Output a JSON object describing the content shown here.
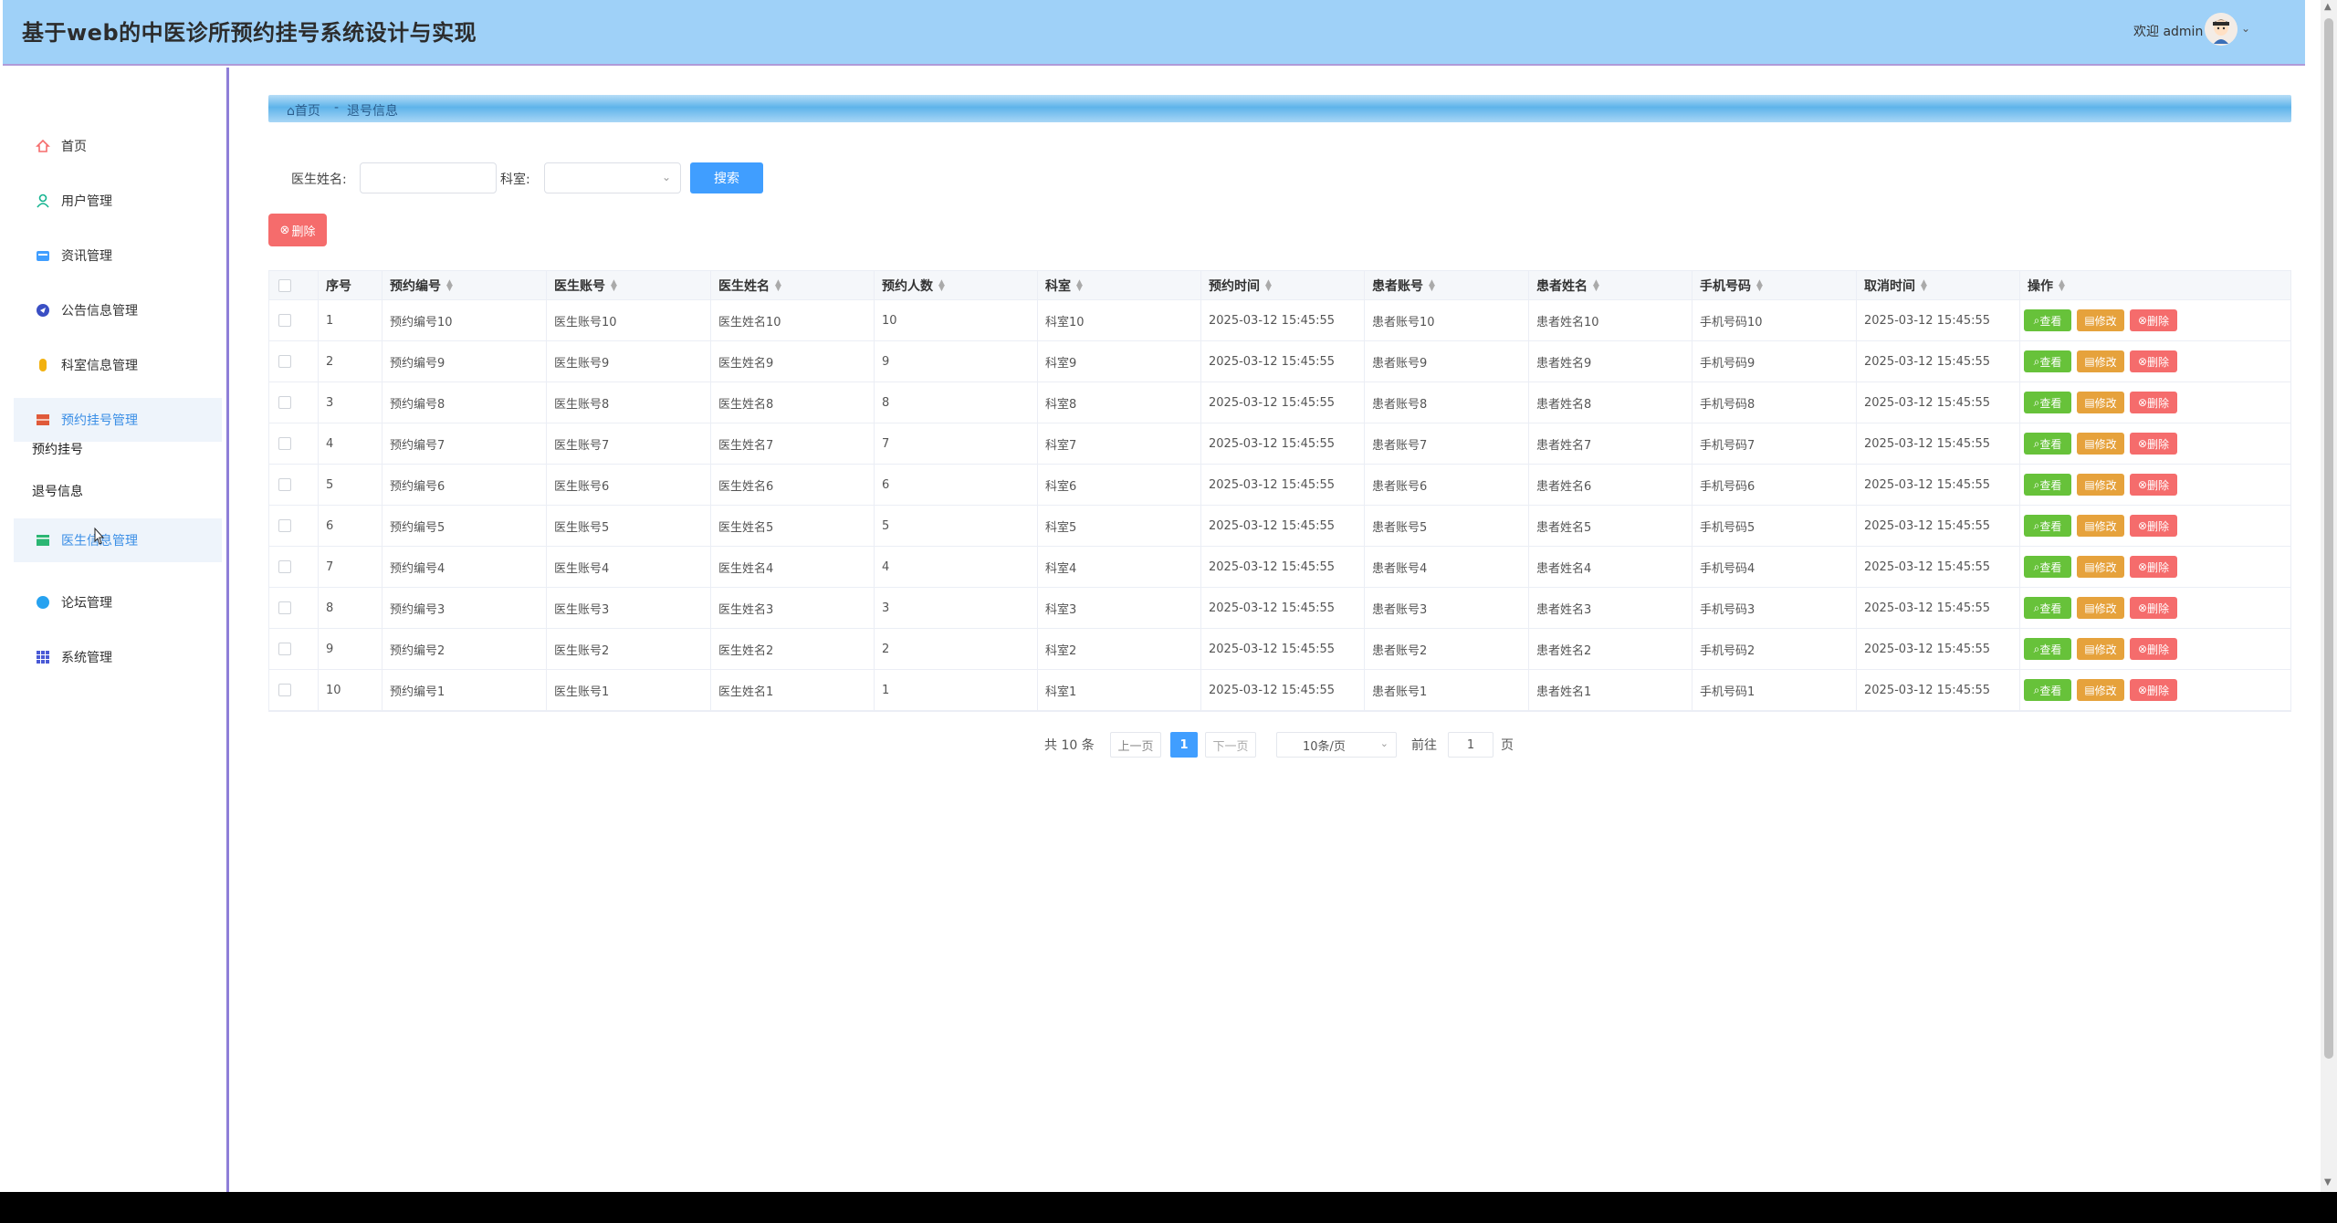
{
  "header": {
    "title": "基于web的中医诊所预约挂号系统设计与实现",
    "welcome": "欢迎 admin"
  },
  "sidebar": {
    "items": [
      {
        "label": "首页",
        "icon": "home-icon",
        "color": "#f56c6c"
      },
      {
        "label": "用户管理",
        "icon": "user-icon",
        "color": "#13b38f"
      },
      {
        "label": "资讯管理",
        "icon": "news-icon",
        "color": "#409eff"
      },
      {
        "label": "公告信息管理",
        "icon": "notice-icon",
        "color": "#3a4fc4"
      },
      {
        "label": "科室信息管理",
        "icon": "department-icon",
        "color": "#f2b10f"
      },
      {
        "label": "预约挂号管理",
        "icon": "appointment-icon",
        "color": "#e05a3a"
      },
      {
        "label": "医生信息管理",
        "icon": "doctor-icon",
        "color": "#2bb673"
      },
      {
        "label": "论坛管理",
        "icon": "forum-icon",
        "color": "#27a2f0"
      },
      {
        "label": "系统管理",
        "icon": "system-icon",
        "color": "#4a5ad6"
      }
    ],
    "sub_items": [
      "预约挂号",
      "退号信息"
    ]
  },
  "breadcrumb": {
    "home": "首页",
    "separator": "-",
    "current": "退号信息"
  },
  "search": {
    "doctor_name_label": "医生姓名:",
    "department_label": "科室:",
    "search_button": "搜索",
    "delete_button": "删除"
  },
  "table": {
    "headers": [
      "序号",
      "预约编号",
      "医生账号",
      "医生姓名",
      "预约人数",
      "科室",
      "预约时间",
      "患者账号",
      "患者姓名",
      "手机号码",
      "取消时间",
      "操作"
    ],
    "rows": [
      [
        "1",
        "预约编号10",
        "医生账号10",
        "医生姓名10",
        "10",
        "科室10",
        "2025-03-12 15:45:55",
        "患者账号10",
        "患者姓名10",
        "手机号码10",
        "2025-03-12 15:45:55"
      ],
      [
        "2",
        "预约编号9",
        "医生账号9",
        "医生姓名9",
        "9",
        "科室9",
        "2025-03-12 15:45:55",
        "患者账号9",
        "患者姓名9",
        "手机号码9",
        "2025-03-12 15:45:55"
      ],
      [
        "3",
        "预约编号8",
        "医生账号8",
        "医生姓名8",
        "8",
        "科室8",
        "2025-03-12 15:45:55",
        "患者账号8",
        "患者姓名8",
        "手机号码8",
        "2025-03-12 15:45:55"
      ],
      [
        "4",
        "预约编号7",
        "医生账号7",
        "医生姓名7",
        "7",
        "科室7",
        "2025-03-12 15:45:55",
        "患者账号7",
        "患者姓名7",
        "手机号码7",
        "2025-03-12 15:45:55"
      ],
      [
        "5",
        "预约编号6",
        "医生账号6",
        "医生姓名6",
        "6",
        "科室6",
        "2025-03-12 15:45:55",
        "患者账号6",
        "患者姓名6",
        "手机号码6",
        "2025-03-12 15:45:55"
      ],
      [
        "6",
        "预约编号5",
        "医生账号5",
        "医生姓名5",
        "5",
        "科室5",
        "2025-03-12 15:45:55",
        "患者账号5",
        "患者姓名5",
        "手机号码5",
        "2025-03-12 15:45:55"
      ],
      [
        "7",
        "预约编号4",
        "医生账号4",
        "医生姓名4",
        "4",
        "科室4",
        "2025-03-12 15:45:55",
        "患者账号4",
        "患者姓名4",
        "手机号码4",
        "2025-03-12 15:45:55"
      ],
      [
        "8",
        "预约编号3",
        "医生账号3",
        "医生姓名3",
        "3",
        "科室3",
        "2025-03-12 15:45:55",
        "患者账号3",
        "患者姓名3",
        "手机号码3",
        "2025-03-12 15:45:55"
      ],
      [
        "9",
        "预约编号2",
        "医生账号2",
        "医生姓名2",
        "2",
        "科室2",
        "2025-03-12 15:45:55",
        "患者账号2",
        "患者姓名2",
        "手机号码2",
        "2025-03-12 15:45:55"
      ],
      [
        "10",
        "预约编号1",
        "医生账号1",
        "医生姓名1",
        "1",
        "科室1",
        "2025-03-12 15:45:55",
        "患者账号1",
        "患者姓名1",
        "手机号码1",
        "2025-03-12 15:45:55"
      ]
    ],
    "ops": {
      "view": "查看",
      "edit": "修改",
      "delete": "删除"
    }
  },
  "pagination": {
    "total": "共 10 条",
    "prev": "上一页",
    "current": "1",
    "next": "下一页",
    "page_size": "10条/页",
    "goto_label": "前往",
    "goto_value": "1",
    "page_suffix": "页"
  },
  "colors": {
    "header_bg": "#9fd1f8",
    "primary": "#409eff",
    "success": "#67c23a",
    "warning": "#e6a23c",
    "danger": "#f56c6c"
  }
}
